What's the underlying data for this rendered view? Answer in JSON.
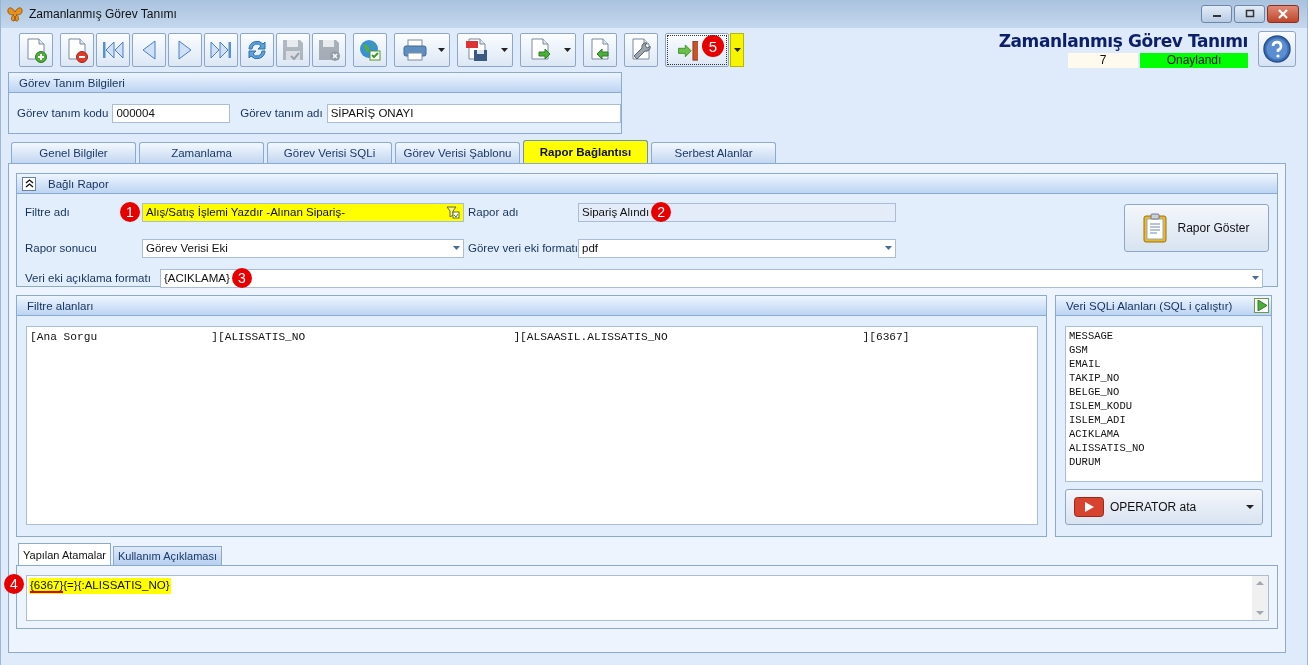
{
  "window": {
    "title": "Zamanlanmış Görev Tanımı"
  },
  "toolbar": [
    {
      "kind": "button",
      "disabled": false
    },
    {
      "kind": "button",
      "disabled": false
    },
    {
      "kind": "button",
      "disabled": false
    },
    {
      "kind": "button",
      "disabled": false
    },
    {
      "kind": "button",
      "disabled": false
    },
    {
      "kind": "button",
      "disabled": false
    },
    {
      "kind": "button",
      "disabled": false
    },
    {
      "kind": "button",
      "disabled": true
    },
    {
      "kind": "button",
      "disabled": true
    },
    {
      "kind": "button",
      "disabled": false
    },
    {
      "kind": "split",
      "disabled": false
    },
    {
      "kind": "split",
      "disabled": false
    },
    {
      "kind": "split",
      "disabled": false
    },
    {
      "kind": "button",
      "disabled": false
    },
    {
      "kind": "button",
      "disabled": false
    },
    {
      "kind": "split",
      "disabled": false,
      "focused": true,
      "highlighted": true,
      "marker": "5"
    }
  ],
  "header": {
    "title": "Zamanlanmış Görev Tanımı",
    "count": "7",
    "status": "Onaylandı"
  },
  "info_group": {
    "title": "Görev Tanım Bilgileri",
    "fields": [
      {
        "label": "Görev tanım kodu",
        "value": "000004"
      },
      {
        "label": "Görev tanım adı",
        "value": "SİPARİŞ ONAYI"
      }
    ]
  },
  "tabs": [
    {
      "label": "Genel Bilgiler",
      "selected": false,
      "highlighted": false
    },
    {
      "label": "Zamanlama",
      "selected": false,
      "highlighted": false
    },
    {
      "label": "Görev Verisi SQLi",
      "selected": false,
      "highlighted": false
    },
    {
      "label": "Görev Verisi Şablonu",
      "selected": false,
      "highlighted": false
    },
    {
      "label": "Rapor Bağlantısı",
      "selected": true,
      "highlighted": true
    },
    {
      "label": "Serbest Alanlar",
      "selected": false,
      "highlighted": false
    }
  ],
  "linked_report": {
    "title": "Bağlı Rapor",
    "expanded": true,
    "fields": [
      {
        "label": "Filtre adı",
        "value": "Alış/Satış İşlemi Yazdır -Alınan Sipariş-",
        "kind": "lookup",
        "highlighted": true,
        "marker": "1"
      },
      {
        "label": "Rapor adı",
        "value": "Sipariş Alındı",
        "kind": "readonly",
        "highlighted": false,
        "marker": "2"
      },
      {
        "label": "Rapor sonucu",
        "value": "Görev Verisi Eki",
        "kind": "dropdown",
        "highlighted": false
      },
      {
        "label": "Görev veri eki formatı",
        "value": "pdf",
        "kind": "dropdown",
        "highlighted": false
      },
      {
        "label": "Veri eki açıklama formatı",
        "value": "{ACIKLAMA}",
        "kind": "dropdown",
        "highlighted": false,
        "marker": "3"
      }
    ],
    "show_button": "Rapor Göster"
  },
  "filter_fields": {
    "title": "Filtre alanları",
    "lines": [
      "[Ana Sorgu                 ][ALISSATIS_NO                               ][ALSAASIL.ALISSATIS_NO                             ][6367]"
    ]
  },
  "sql_fields": {
    "title": "Veri SQLi Alanları (SQL i çalıştır)",
    "items": [
      "MESSAGE",
      "GSM",
      "EMAIL",
      "TAKIP_NO",
      "BELGE_NO",
      "ISLEM_KODU",
      "ISLEM_ADI",
      "ACIKLAMA",
      "ALISSATIS_NO",
      "DURUM"
    ],
    "operator_button": "OPERATOR ata"
  },
  "bottom_tabs": [
    {
      "label": "Yapılan Atamalar",
      "selected": true
    },
    {
      "label": "Kullanım Açıklaması",
      "selected": false
    }
  ],
  "assignments": {
    "marker": "4",
    "highlighted": true,
    "parts": [
      {
        "text": "{6367}",
        "underlined": true
      },
      {
        "text": "{=}{:ALISSATIS_NO}",
        "underlined": false
      }
    ]
  }
}
